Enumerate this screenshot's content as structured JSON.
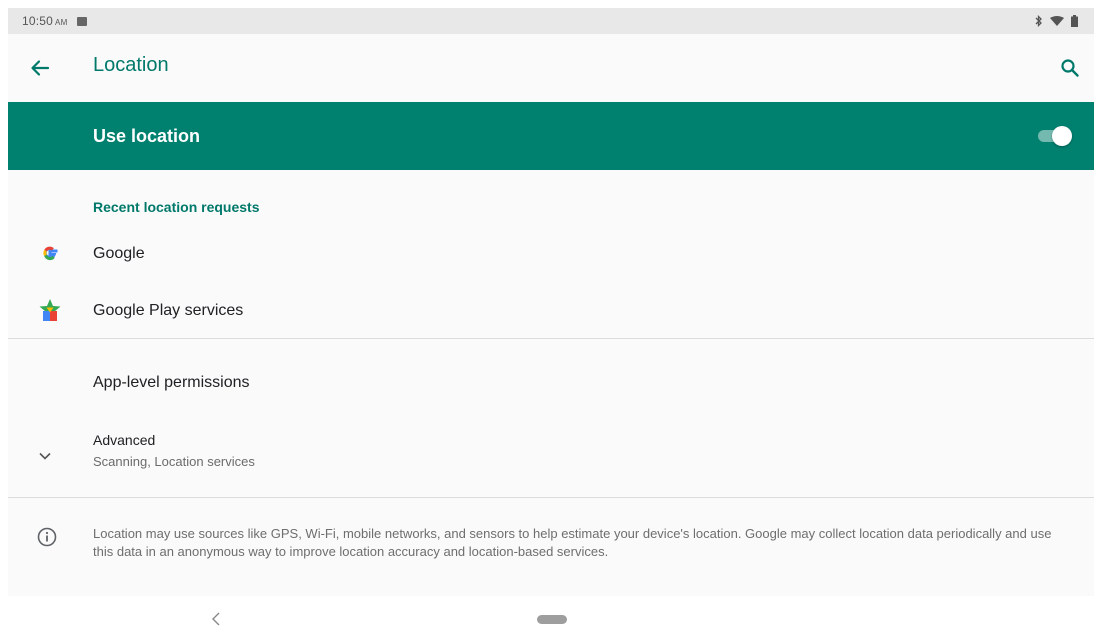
{
  "status_bar": {
    "time": "10:50",
    "ampm": "AM",
    "icons": [
      "notification-icon",
      "bluetooth-icon",
      "wifi-icon",
      "battery-icon"
    ]
  },
  "app_bar": {
    "title": "Location",
    "back_icon": "arrow-back-icon",
    "search_icon": "search-icon",
    "accent_color": "#00796b"
  },
  "master_switch": {
    "label": "Use location",
    "on": true,
    "background_color": "#00806f"
  },
  "recent_requests": {
    "header": "Recent location requests",
    "items": [
      {
        "label": "Google",
        "icon": "google-g-icon"
      },
      {
        "label": "Google Play services",
        "icon": "google-play-services-icon"
      }
    ]
  },
  "app_level_permissions": {
    "label": "App-level permissions"
  },
  "advanced": {
    "title": "Advanced",
    "summary": "Scanning, Location services",
    "icon": "chevron-down-icon"
  },
  "info": {
    "icon": "info-icon",
    "text": "Location may use sources like GPS, Wi-Fi, mobile networks, and sensors to help estimate your device's location. Google may collect location data periodically and use this data in an anonymous way to improve location accuracy and location-based services."
  },
  "nav_bar": {
    "back_icon": "nav-back-icon",
    "home_icon": "nav-home-pill-icon"
  }
}
